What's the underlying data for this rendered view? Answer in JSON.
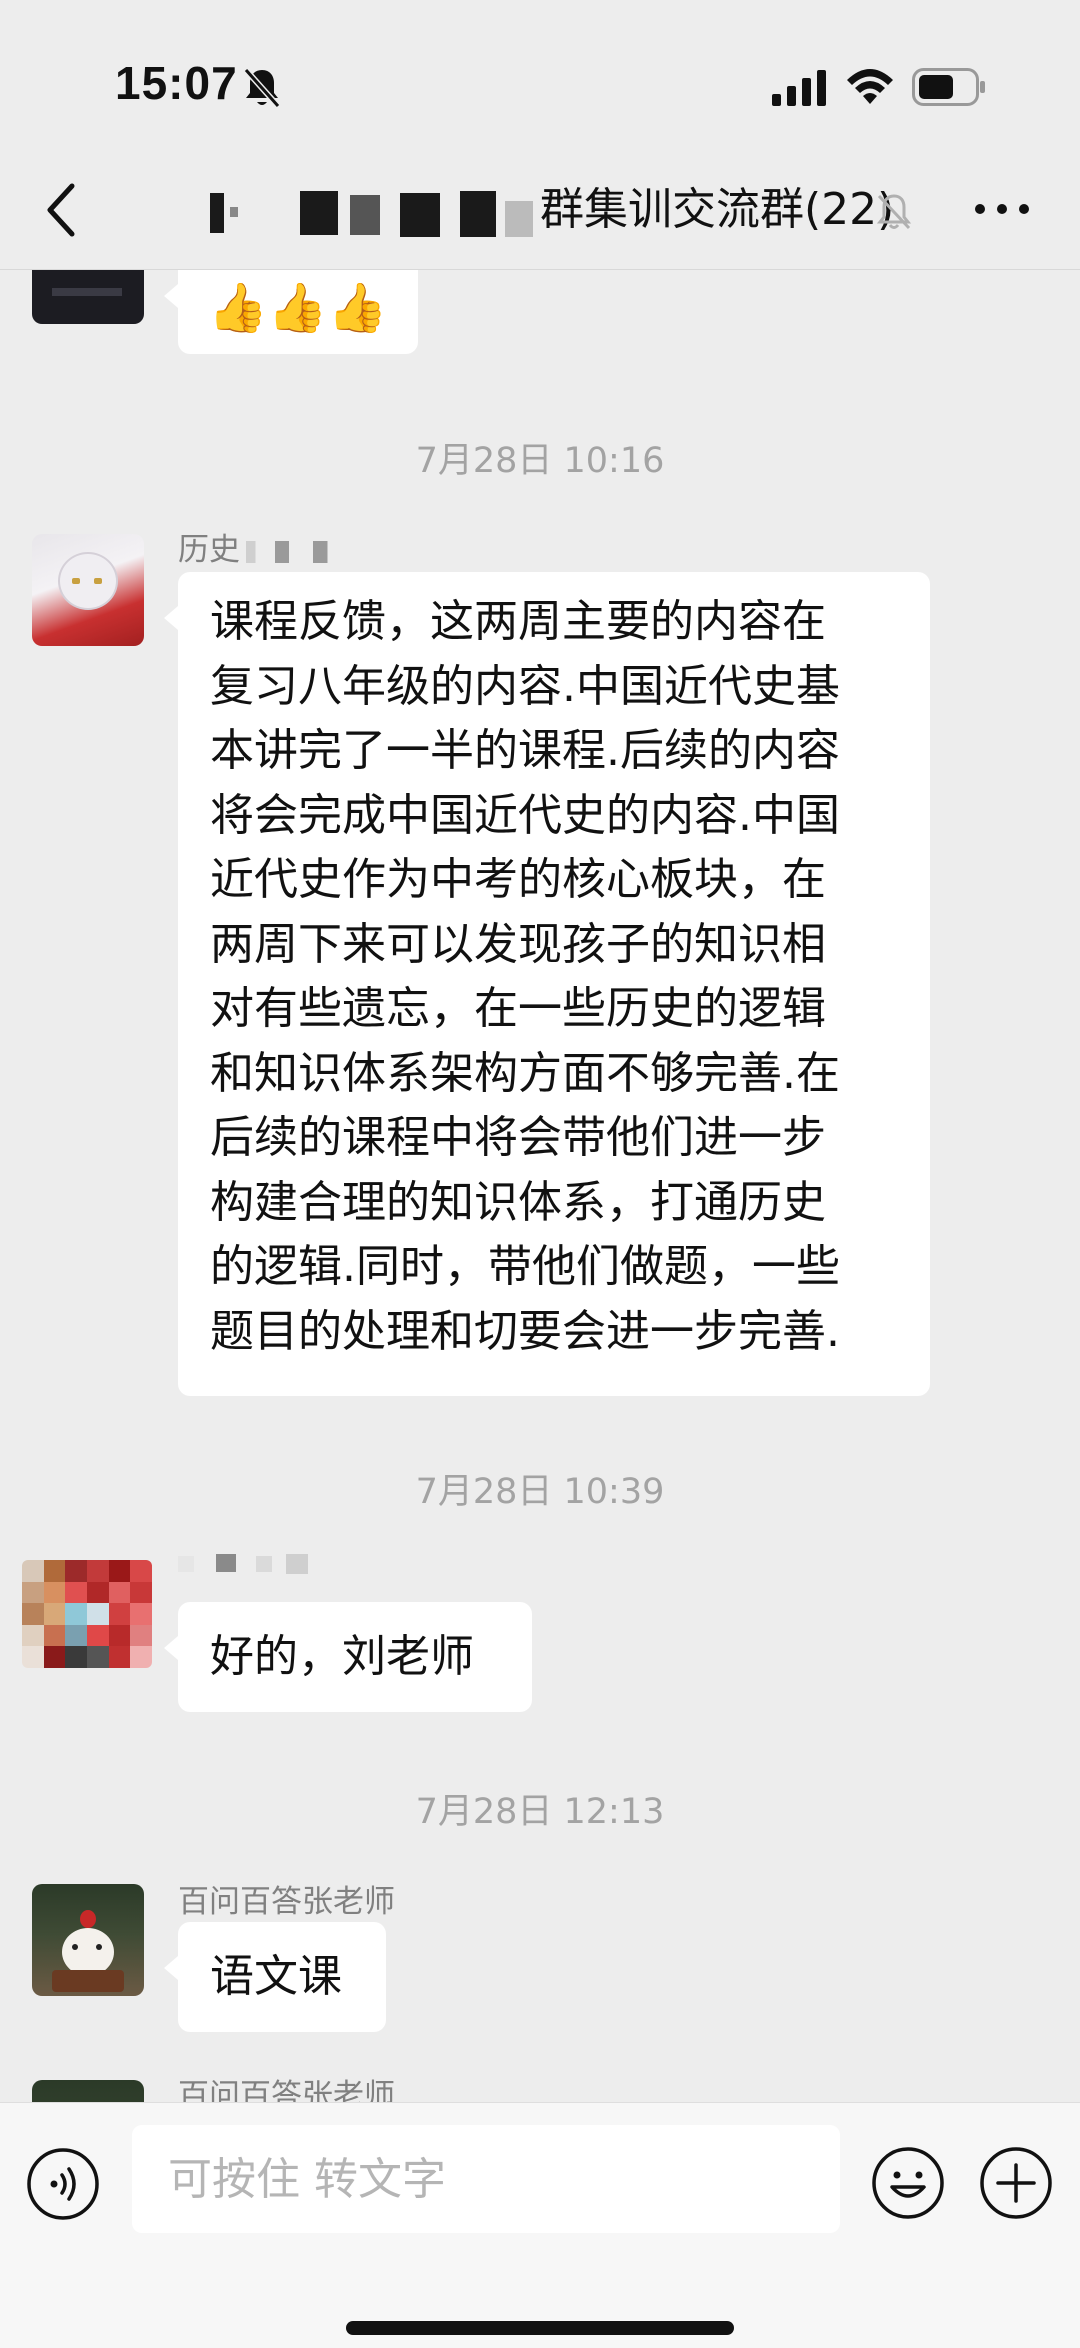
{
  "status_bar": {
    "time": "15:07"
  },
  "nav": {
    "title_visible": "群集训交流群(22)"
  },
  "messages": [
    {
      "type": "emoji",
      "emoji": [
        "👍",
        "👍",
        "👍"
      ]
    },
    {
      "type": "timestamp",
      "text": "7月28日 10:16"
    },
    {
      "type": "text",
      "sender": "历史",
      "text_lines": [
        "课程反馈，这两周主要的内容在",
        "复习八年级的内容.中国近代史基",
        "本讲完了一半的课程.后续的内容",
        "将会完成中国近代史的内容.中国",
        "近代史作为中考的核心板块，在",
        "两周下来可以发现孩子的知识相",
        "对有些遗忘，在一些历史的逻辑",
        "和知识体系架构方面不够完善.在",
        "后续的课程中将会带他们进一步",
        "构建合理的知识体系，打通历史",
        "的逻辑.同时，带他们做题，一些",
        "题目的处理和切要会进一步完善."
      ]
    },
    {
      "type": "timestamp",
      "text": "7月28日 10:39"
    },
    {
      "type": "text",
      "sender": "",
      "text": "好的，刘老师"
    },
    {
      "type": "timestamp",
      "text": "7月28日 12:13"
    },
    {
      "type": "text",
      "sender": "百问百答张老师",
      "text": "语文课"
    },
    {
      "type": "partial",
      "sender": "百问百答张老师"
    }
  ],
  "input": {
    "placeholder": "可按住 转文字"
  },
  "icons": {
    "bell_slash": "bell-slash-icon",
    "signal": "cellular-signal-icon",
    "wifi": "wifi-icon",
    "battery": "battery-icon",
    "back": "chevron-left-icon",
    "mute": "muted-bell-icon",
    "more": "more-dots-icon",
    "voice": "voice-input-icon",
    "emoji": "emoji-face-icon",
    "plus": "plus-circle-icon"
  },
  "colors": {
    "background": "#ededed",
    "bubble": "#ffffff",
    "timestamp": "#a3a3a3",
    "sender": "#808080"
  }
}
